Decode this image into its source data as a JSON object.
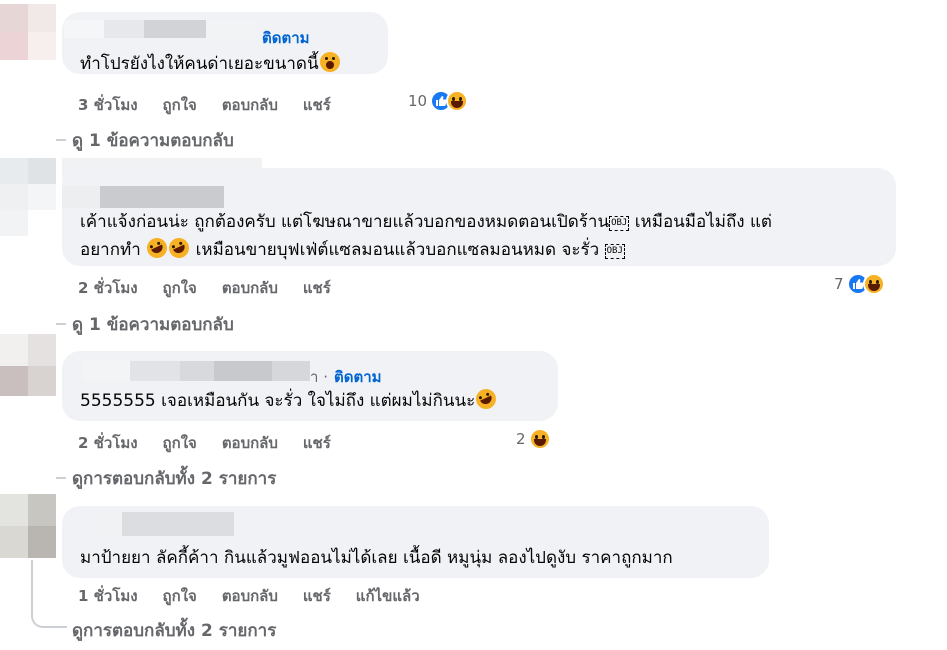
{
  "comments": [
    {
      "follow": "ติดตาม",
      "text": "ทำโปรยังไงให้คนด่าเยอะขนาดนี้",
      "time": "3 ชั่วโมง",
      "like": "ถูกใจ",
      "reply": "ตอบกลับ",
      "share": "แชร์",
      "reaction_count": "10",
      "view_replies": "ดู 1 ข้อความตอบกลับ"
    },
    {
      "text_line1": "เค้าแจ้งก่อนน่ะ ถูกต้องครับ แต่โฆษณาขายแล้วบอกของหมดตอนเปิดร้าน",
      "text_line1b": " เหมือนมือไม่ถึง แต่",
      "text_line2a": "อยากทำ ",
      "text_line2b": " เหมือนขายบุฟเฟ่ต์แซลมอนแล้วบอกแซลมอนหมด จะรั่ว ",
      "obj": "OBJ",
      "time": "2 ชั่วโมง",
      "like": "ถูกใจ",
      "reply": "ตอบกลับ",
      "share": "แชร์",
      "reaction_count": "7",
      "view_replies": "ดู 1 ข้อความตอบกลับ"
    },
    {
      "name_tail": "า ·",
      "follow": "ติดตาม",
      "text": "5555555 เจอเหมือนกัน จะรั่ว ใจไม่ถึง แต่ผมไม่กินนะ",
      "time": "2 ชั่วโมง",
      "like": "ถูกใจ",
      "reply": "ตอบกลับ",
      "share": "แชร์",
      "reaction_count": "2",
      "view_replies": "ดูการตอบกลับทั้ง 2 รายการ"
    },
    {
      "text": "มาป้ายยา ลัคกี้ค้าา กินแล้วมูฟออนไม่ได้เลย เนื้อดี หมูนุ่ม ลองไปดูงับ ราคาถูกมาก",
      "time": "1 ชั่วโมง",
      "like": "ถูกใจ",
      "reply": "ตอบกลับ",
      "share": "แชร์",
      "edited": "แก้ไขแล้ว",
      "view_replies": "ดูการตอบกลับทั้ง 2 รายการ"
    }
  ],
  "colors": {
    "bubble": "#f0f2f5",
    "link": "#0064d1",
    "meta": "#65676b",
    "like": "#1877f2",
    "haha": "#f7b125"
  },
  "icons": [
    "like-icon",
    "haha-icon",
    "scream-emoji",
    "rofl-emoji",
    "obj-placeholder-icon"
  ]
}
